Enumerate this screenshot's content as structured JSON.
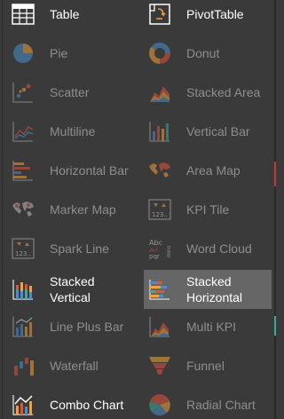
{
  "chart_types": [
    {
      "label": "Table",
      "icon": "table-icon",
      "enabled": true
    },
    {
      "label": "PivotTable",
      "icon": "pivot-table-icon",
      "enabled": true
    },
    {
      "label": "Pie",
      "icon": "pie-chart-icon",
      "enabled": false
    },
    {
      "label": "Donut",
      "icon": "donut-chart-icon",
      "enabled": false
    },
    {
      "label": "Scatter",
      "icon": "scatter-chart-icon",
      "enabled": false
    },
    {
      "label": "Stacked Area",
      "icon": "stacked-area-chart-icon",
      "enabled": false
    },
    {
      "label": "Multiline",
      "icon": "multiline-chart-icon",
      "enabled": false
    },
    {
      "label": "Vertical Bar",
      "icon": "vertical-bar-chart-icon",
      "enabled": false
    },
    {
      "label": "Horizontal Bar",
      "icon": "horizontal-bar-chart-icon",
      "enabled": false
    },
    {
      "label": "Area Map",
      "icon": "area-map-icon",
      "enabled": false
    },
    {
      "label": "Marker Map",
      "icon": "marker-map-icon",
      "enabled": false
    },
    {
      "label": "KPI Tile",
      "icon": "kpi-tile-icon",
      "enabled": false
    },
    {
      "label": "Spark Line",
      "icon": "spark-line-icon",
      "enabled": false
    },
    {
      "label": "Word Cloud",
      "icon": "word-cloud-icon",
      "enabled": false
    },
    {
      "label": "Stacked Vertical",
      "icon": "stacked-vertical-bar-icon",
      "enabled": true
    },
    {
      "label": "Stacked Horizontal",
      "icon": "stacked-horizontal-bar-icon",
      "enabled": true,
      "selected": true
    },
    {
      "label": "Line Plus Bar",
      "icon": "line-plus-bar-icon",
      "enabled": false
    },
    {
      "label": "Multi KPI",
      "icon": "multi-kpi-icon",
      "enabled": false
    },
    {
      "label": "Waterfall",
      "icon": "waterfall-chart-icon",
      "enabled": false
    },
    {
      "label": "Funnel",
      "icon": "funnel-chart-icon",
      "enabled": false
    },
    {
      "label": "Combo Chart",
      "icon": "combo-chart-icon",
      "enabled": true
    },
    {
      "label": "Radial Chart",
      "icon": "radial-chart-icon",
      "enabled": false
    }
  ],
  "kpi_glyph_text": "123..",
  "word_cloud_glyph_text": [
    "Abc",
    "def",
    "pqr",
    "mno"
  ],
  "colors": {
    "background": "#3a3a3a",
    "selected_background": "#666666",
    "label_enabled": "#ffffff",
    "label_disabled": "#8e8e8e",
    "accent_red": "#e0533b",
    "accent_orange": "#f2a13a",
    "accent_blue": "#4a8ed0",
    "accent_teal": "#3fa89a"
  }
}
